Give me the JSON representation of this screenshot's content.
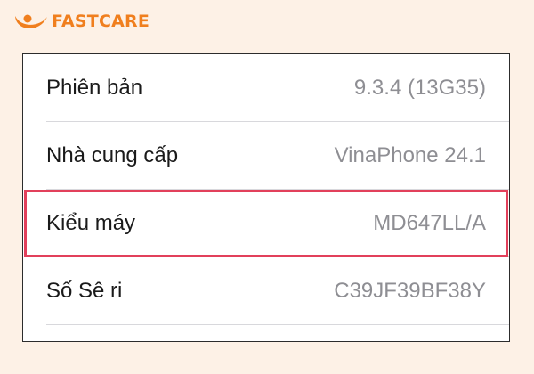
{
  "brand": {
    "name": "FASTCARE",
    "color": "#f07f1e"
  },
  "settings": {
    "highlight_color": "#e2405b",
    "rows": [
      {
        "label": "Phiên bản",
        "value": "9.3.4 (13G35)"
      },
      {
        "label": "Nhà cung cấp",
        "value": "VinaPhone 24.1"
      },
      {
        "label": "Kiểu máy",
        "value": "MD647LL/A",
        "highlighted": true
      },
      {
        "label": "Số Sê ri",
        "value": "C39JF39BF38Y"
      }
    ]
  }
}
